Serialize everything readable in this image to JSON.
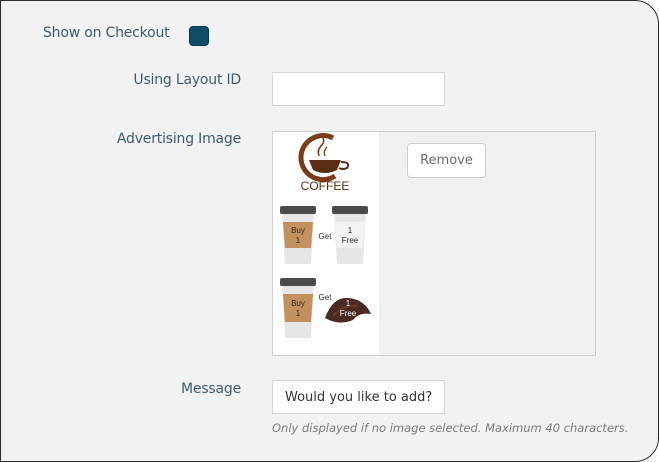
{
  "form": {
    "show_on_checkout": {
      "label": "Show on Checkout",
      "checked": true,
      "color": "#0f4a66"
    },
    "layout_id": {
      "label": "Using Layout ID",
      "value": ""
    },
    "advertising_image": {
      "label": "Advertising Image",
      "remove_label": "Remove",
      "image": {
        "brand_text": "COFFEE",
        "row1": {
          "left_cup": "Buy\n1",
          "middle": "Get",
          "right_cup": "1\nFree"
        },
        "row2": {
          "left_cup": "Buy\n1",
          "middle": "Get",
          "right_item": "1\nFree"
        }
      }
    },
    "message": {
      "label": "Message",
      "value": "Would you like to add?",
      "help": "Only displayed if no image selected. Maximum 40 characters."
    }
  }
}
